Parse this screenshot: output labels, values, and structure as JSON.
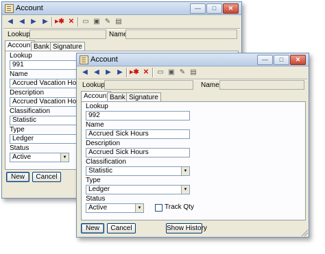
{
  "back_window": {
    "title": "Account",
    "toolbar": [
      "first-icon",
      "previous-icon",
      "next-icon",
      "last-icon",
      "jump-icon",
      "delete-icon",
      "find-icon",
      "save-icon",
      "edit-icon",
      "print-icon"
    ],
    "lookup_label": "Lookup",
    "name_label": "Name",
    "tabs": [
      "Account",
      "Bank",
      "Signature"
    ],
    "fields": {
      "lookup_label": "Lookup",
      "lookup_value": "991",
      "name_label": "Name",
      "name_value": "Accrued Vacation Hours",
      "description_label": "Description",
      "description_value": "Accrued Vacation Hours",
      "classification_label": "Classification",
      "classification_value": "Statistic",
      "type_label": "Type",
      "type_value": "Ledger",
      "status_label": "Status",
      "status_value": "Active"
    },
    "buttons": {
      "new": "New",
      "cancel": "Cancel"
    }
  },
  "front_window": {
    "title": "Account",
    "toolbar": [
      "first-icon",
      "previous-icon",
      "next-icon",
      "last-icon",
      "jump-icon",
      "delete-icon",
      "find-icon",
      "save-icon",
      "edit-icon",
      "print-icon"
    ],
    "lookup_label": "Lookup",
    "name_label": "Name",
    "tabs": [
      "Account",
      "Bank",
      "Signature"
    ],
    "fields": {
      "lookup_label": "Lookup",
      "lookup_value": "992",
      "name_label": "Name",
      "name_value": "Accrued Sick Hours",
      "description_label": "Description",
      "description_value": "Accrued Sick Hours",
      "classification_label": "Classification",
      "classification_value": "Statistic",
      "type_label": "Type",
      "type_value": "Ledger",
      "status_label": "Status",
      "status_value": "Active",
      "track_qty_label": "Track Qty"
    },
    "buttons": {
      "new": "New",
      "cancel": "Cancel",
      "show_history": "Show History"
    }
  }
}
